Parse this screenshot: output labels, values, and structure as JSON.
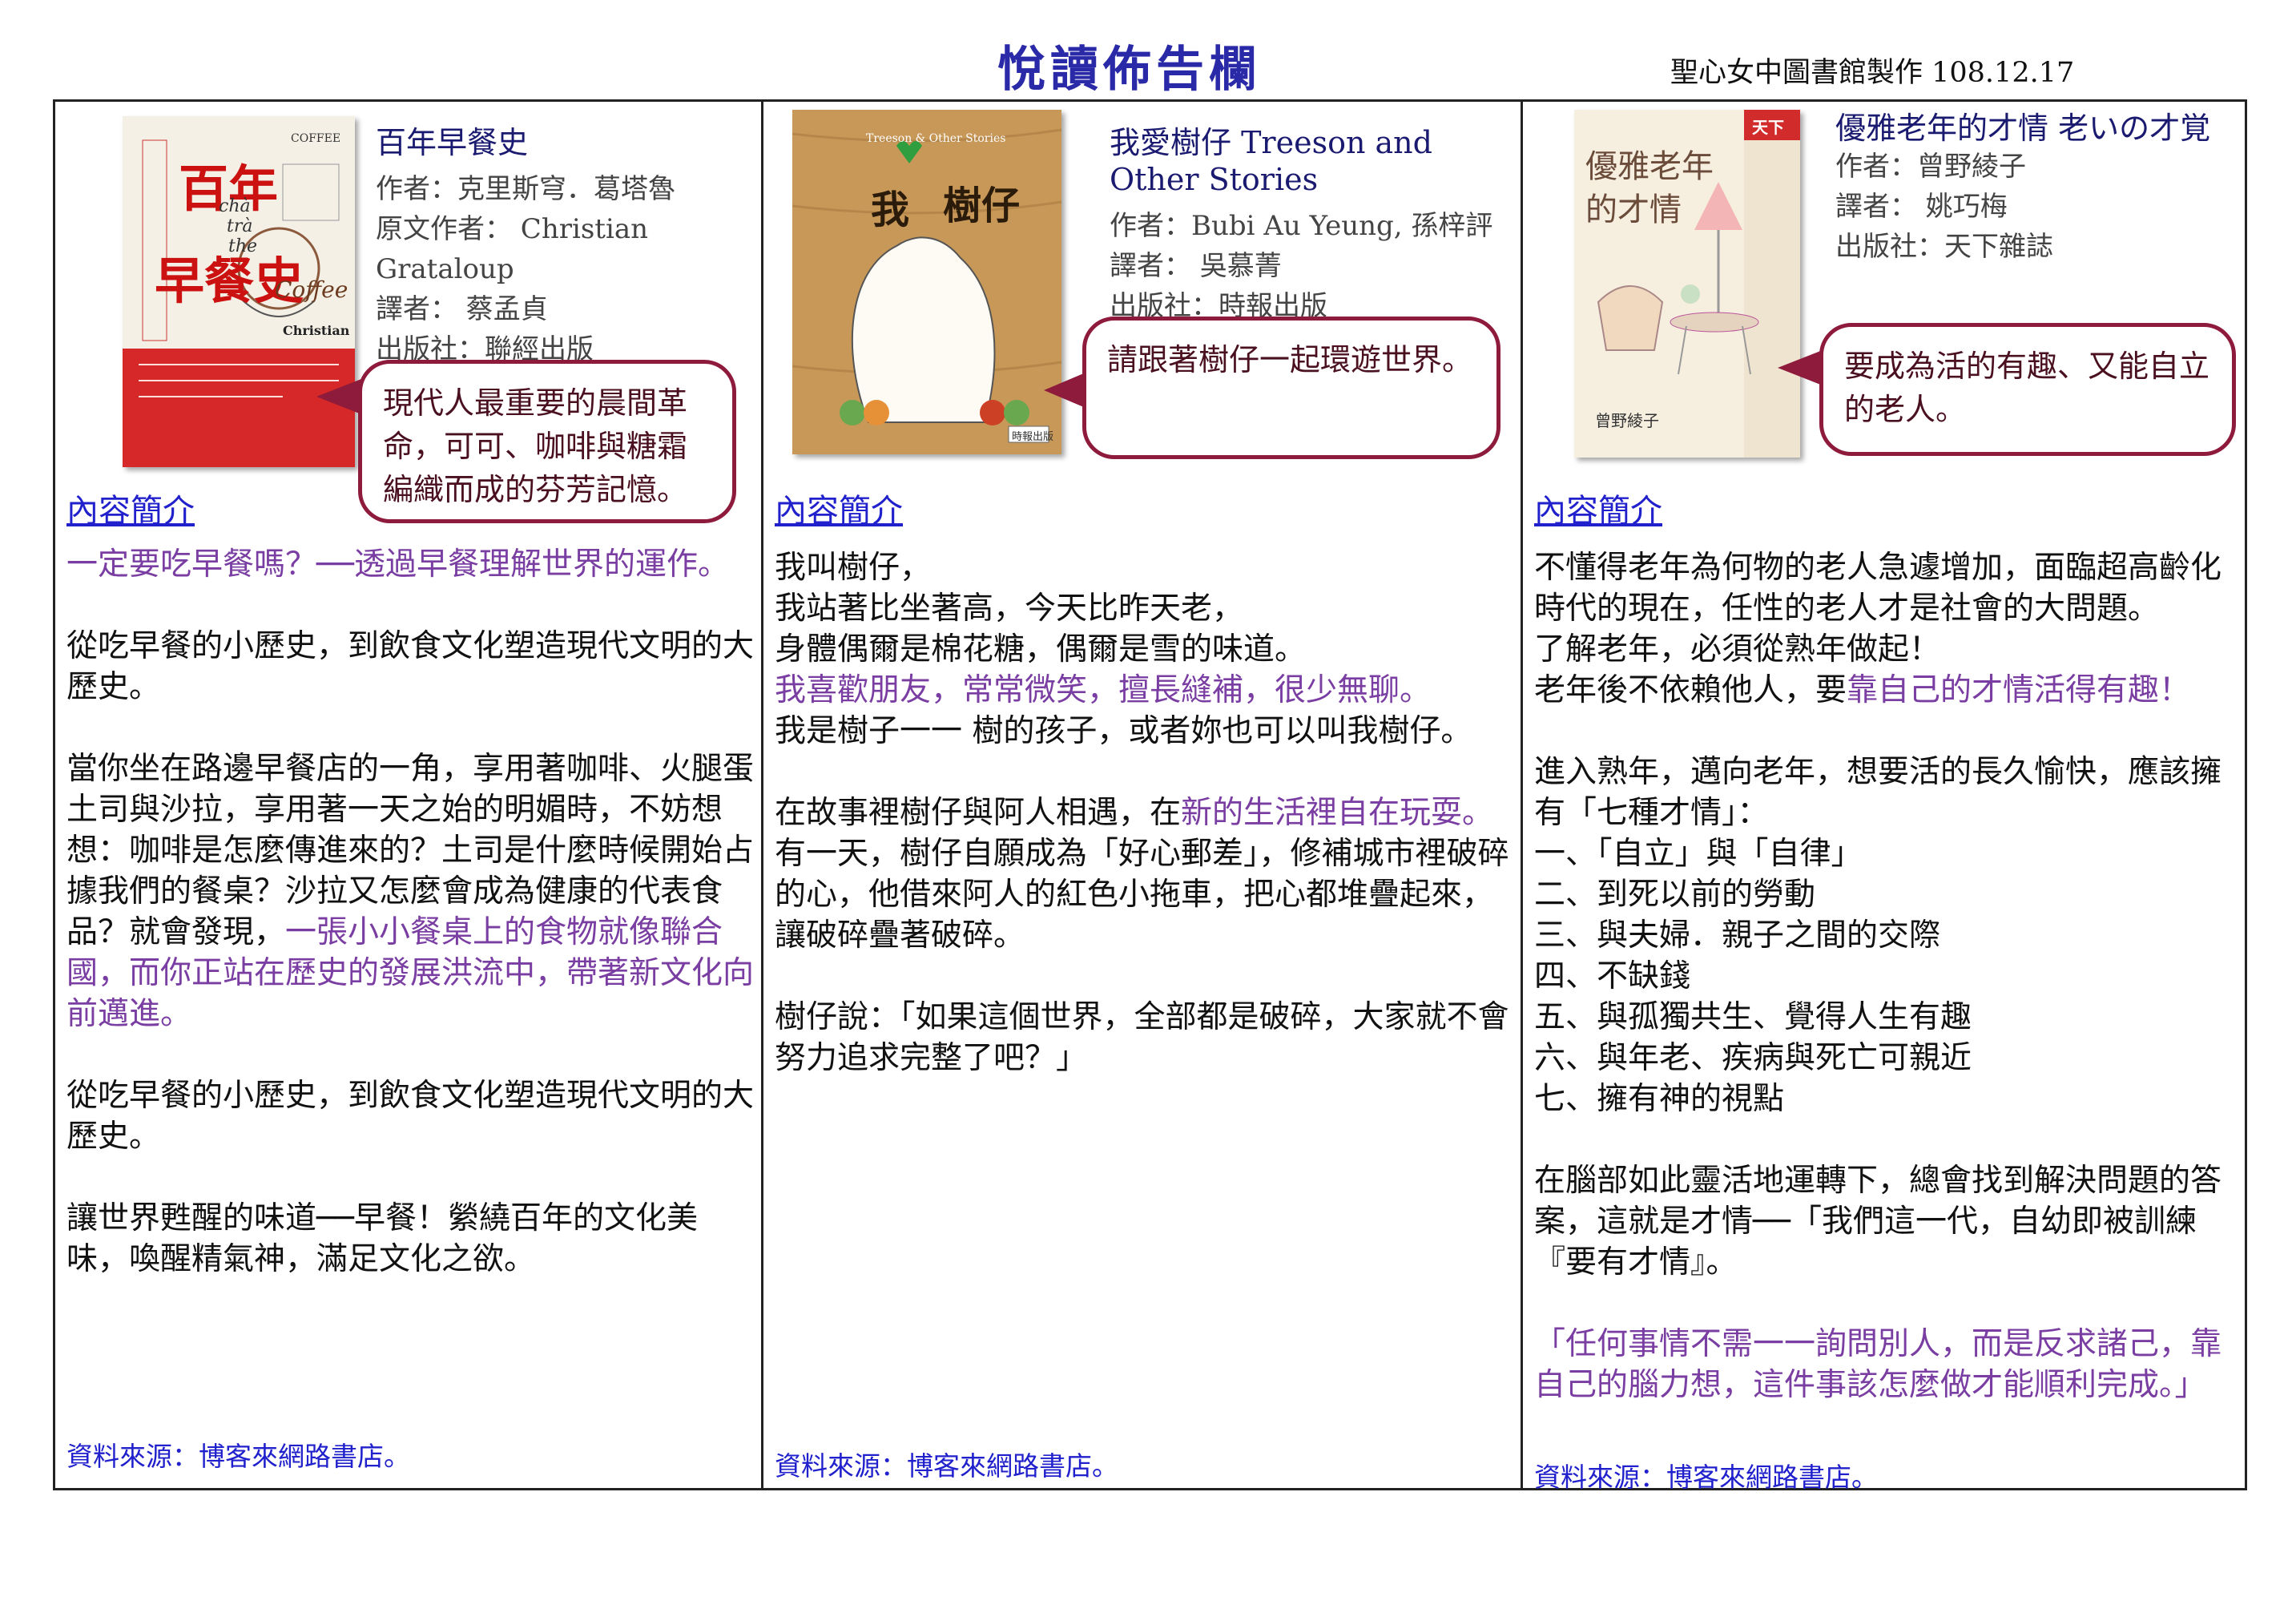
{
  "header": {
    "title": "悅讀佈告欄",
    "maker": "聖心女中圖書館製作 108.12.17"
  },
  "books": [
    {
      "title": "百年早餐史",
      "author": "作者：克里斯穹．葛塔魯",
      "original_author": "原文作者： Christian Grataloup",
      "translator": "譯者： 蔡孟貞",
      "publisher": "出版社：聯經出版",
      "cover_text": [
        "百年",
        "早餐史",
        "COFFEE",
        "chà",
        "trà",
        "the",
        "Coffee",
        "Christian"
      ],
      "bubble": "現代人最重要的晨間革命，可可、咖啡與糖霜編織而成的芬芳記憶。",
      "intro_label": "內容簡介",
      "paragraphs": [
        {
          "text": "一定要吃早餐嗎？──透過早餐理解世界的運作。",
          "style": "purple"
        },
        {
          "text": "從吃早餐的小歷史，到飲食文化塑造現代文明的大歷史。"
        },
        {
          "text": "當你坐在路邊早餐店的一角，享用著咖啡、火腿蛋土司與沙拉，享用著一天之始的明媚時，不妨想想：咖啡是怎麼傳進來的？土司是什麼時候開始占據我們的餐桌？沙拉又怎麼會成為健康的代表食品？就會發現，",
          "highlight": "一張小小餐桌上的食物就像聯合國，而你正站在歷史的發展洪流中，帶著新文化向前邁進。"
        },
        {
          "text": "從吃早餐的小歷史，到飲食文化塑造現代文明的大歷史。"
        },
        {
          "text": "讓世界甦醒的味道──早餐！縈繞百年的文化美味，喚醒精氣神，滿足文化之欲。"
        }
      ],
      "source": "資料來源：博客來網路書店。"
    },
    {
      "title": "我愛樹仔 Treeson and Other Stories",
      "author": "作者：Bubi Au Yeung, 孫梓評",
      "translator": "譯者： 吳慕菁",
      "publisher": "出版社：時報出版",
      "cover_text": [
        "Treeson & Other Stories",
        "我",
        "樹仔",
        "時報出版"
      ],
      "bubble": "請跟著樹仔一起環遊世界。",
      "intro_label": "內容簡介",
      "lines": [
        {
          "text": "我叫樹仔，"
        },
        {
          "text": "我站著比坐著高，今天比昨天老，"
        },
        {
          "text": "身體偶爾是棉花糖，偶爾是雪的味道。"
        },
        {
          "text": "我喜歡朋友，常常微笑，擅長縫補，很少無聊。",
          "style": "purple"
        },
        {
          "text": "我是樹子一一 樹的孩子，或者妳也可以叫我樹仔。"
        }
      ],
      "paragraphs": [
        {
          "text": "在故事裡樹仔與阿人相遇，在",
          "highlight": "新的生活裡自在玩耍。",
          "rest": "有一天，樹仔自願成為「好心郵差」，修補城市裡破碎的心，他借來阿人的紅色小拖車，把心都堆疊起來，讓破碎疊著破碎。"
        },
        {
          "text": "樹仔說：「如果這個世界，全部都是破碎，大家就不會努力追求完整了吧？」"
        }
      ],
      "source": "資料來源：博客來網路書店。"
    },
    {
      "title": "優雅老年的才情 老いの才覚",
      "author": "作者：曾野綾子",
      "translator": "譯者： 姚巧梅",
      "publisher": "出版社：天下雜誌",
      "cover_text": [
        "優雅老年",
        "的才情",
        "天下",
        "曾野綾子"
      ],
      "bubble": "要成為活的有趣、又能自立的老人。",
      "intro_label": "內容簡介",
      "lines_top": [
        {
          "text": "不懂得老年為何物的老人急遽增加，面臨超高齡化時代的現在，任性的老人才是社會的大問題。"
        },
        {
          "text": "了解老年，必須從熟年做起！"
        },
        {
          "text": "老年後不依賴他人，要",
          "highlight": "靠自己的才情活得有趣！"
        }
      ],
      "lines_mid": [
        {
          "text": "進入熟年，邁向老年，想要活的長久愉快，應該擁有「七種才情」："
        },
        {
          "text": "一、「自立」與「自律」"
        },
        {
          "text": "二、到死以前的勞動"
        },
        {
          "text": "三、與夫婦．親子之間的交際"
        },
        {
          "text": "四、不缺錢"
        },
        {
          "text": "五、與孤獨共生、覺得人生有趣"
        },
        {
          "text": "六、與年老、疾病與死亡可親近"
        },
        {
          "text": "七、擁有神的視點"
        }
      ],
      "para_brain": "在腦部如此靈活地運轉下，總會找到解決問題的答案，這就是才情──「我們這一代，自幼即被訓練『要有才情』。",
      "quote": "「任何事情不需一一詢問別人，而是反求諸己，靠自己的腦力想，這件事該怎麼做才能順利完成。」",
      "source": "資料來源：博客來網路書店。"
    }
  ],
  "colors": {
    "title_blue": "#2a2aa8",
    "link_blue": "#2020cc",
    "highlight_purple": "#7a3ea3",
    "bubble_border": "#8e1b3c"
  }
}
